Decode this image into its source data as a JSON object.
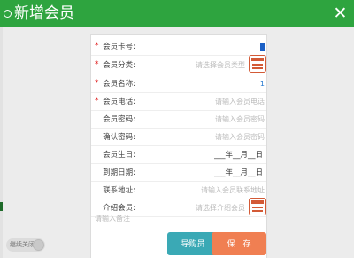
{
  "header": {
    "title": "新增会员",
    "close_label": "✕"
  },
  "form": {
    "card_no": {
      "label": "会员卡号:",
      "required": "*",
      "value": "1"
    },
    "category": {
      "label": "会员分类:",
      "required": "*",
      "placeholder": "请选择会员类型"
    },
    "name": {
      "label": "会员名称:",
      "required": "*",
      "value": "1"
    },
    "phone": {
      "label": "会员电话:",
      "required": "*",
      "placeholder": "请输入会员电话"
    },
    "password": {
      "label": "会员密码:",
      "placeholder": "请输入会员密码"
    },
    "confirm_password": {
      "label": "确认密码:",
      "placeholder": "请输入会员密码"
    },
    "birthday": {
      "label": "会员生日:",
      "value": "___年__月__日"
    },
    "expiry": {
      "label": "到期日期:",
      "value": "___年__月__日"
    },
    "address": {
      "label": "联系地址:",
      "placeholder": "请输入会员联系地址"
    },
    "referrer": {
      "label": "介绍会员:",
      "placeholder": "请选择介绍会员"
    },
    "remark": {
      "placeholder": "请输入备注"
    }
  },
  "buttons": {
    "guide": "导购员",
    "save": "保　存"
  },
  "toggle": {
    "label": "继续关闭"
  },
  "colors": {
    "header": "#2ea43f",
    "guide_button": "#3aa9b5",
    "save_button": "#f07f52",
    "required": "#e01b1b",
    "picker": "#d35a36"
  }
}
